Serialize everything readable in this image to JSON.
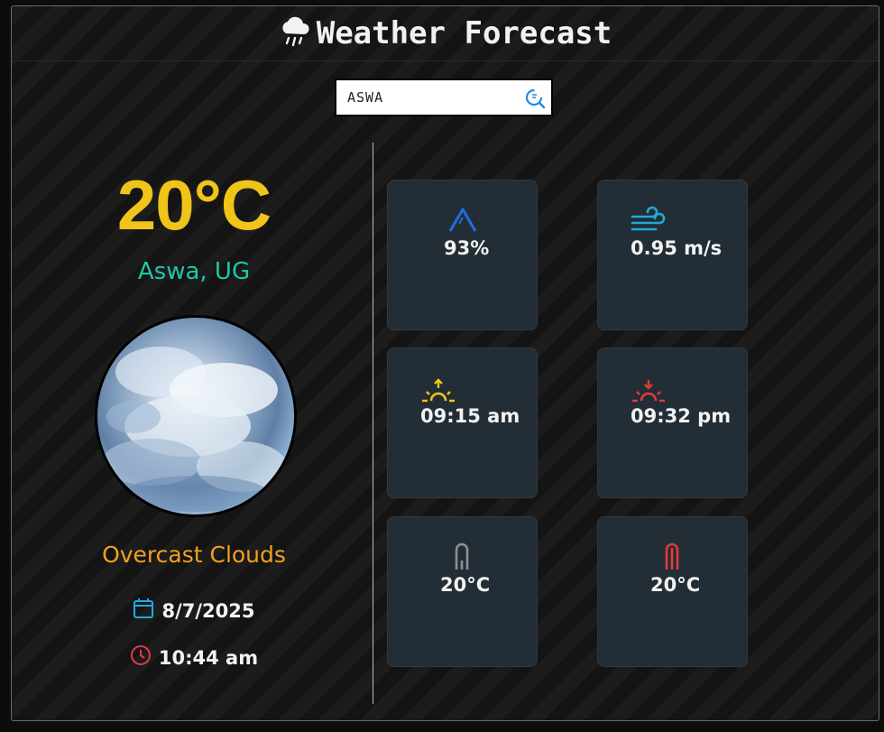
{
  "header": {
    "title": "Weather Forecast",
    "icon": "cloud-rain-icon"
  },
  "search": {
    "value": "ASWA",
    "button_icon": "search-refresh-icon"
  },
  "current": {
    "temperature": "20°C",
    "location": "Aswa, UG",
    "condition": "Overcast Clouds",
    "date": "8/7/2025",
    "time": "10:44 am"
  },
  "cards": {
    "humidity": {
      "value": "93%",
      "icon": "humidity-icon",
      "color": "#1e6fe0"
    },
    "wind": {
      "value": "0.95 m/s",
      "icon": "wind-icon",
      "color": "#22a9d6"
    },
    "sunrise": {
      "value": "09:15 am",
      "icon": "sunrise-icon",
      "color": "#f0c419"
    },
    "sunset": {
      "value": "09:32 pm",
      "icon": "sunset-icon",
      "color": "#e03a3a"
    },
    "temp_min": {
      "value": "20°C",
      "icon": "thermometer-low-icon",
      "color": "#8a9199"
    },
    "temp_max": {
      "value": "20°C",
      "icon": "thermometer-high-icon",
      "color": "#e03a3a"
    }
  },
  "colors": {
    "temperature": "#f0c419",
    "location": "#1fc7a6",
    "condition": "#f0a020",
    "card_bg": "#232d35"
  }
}
